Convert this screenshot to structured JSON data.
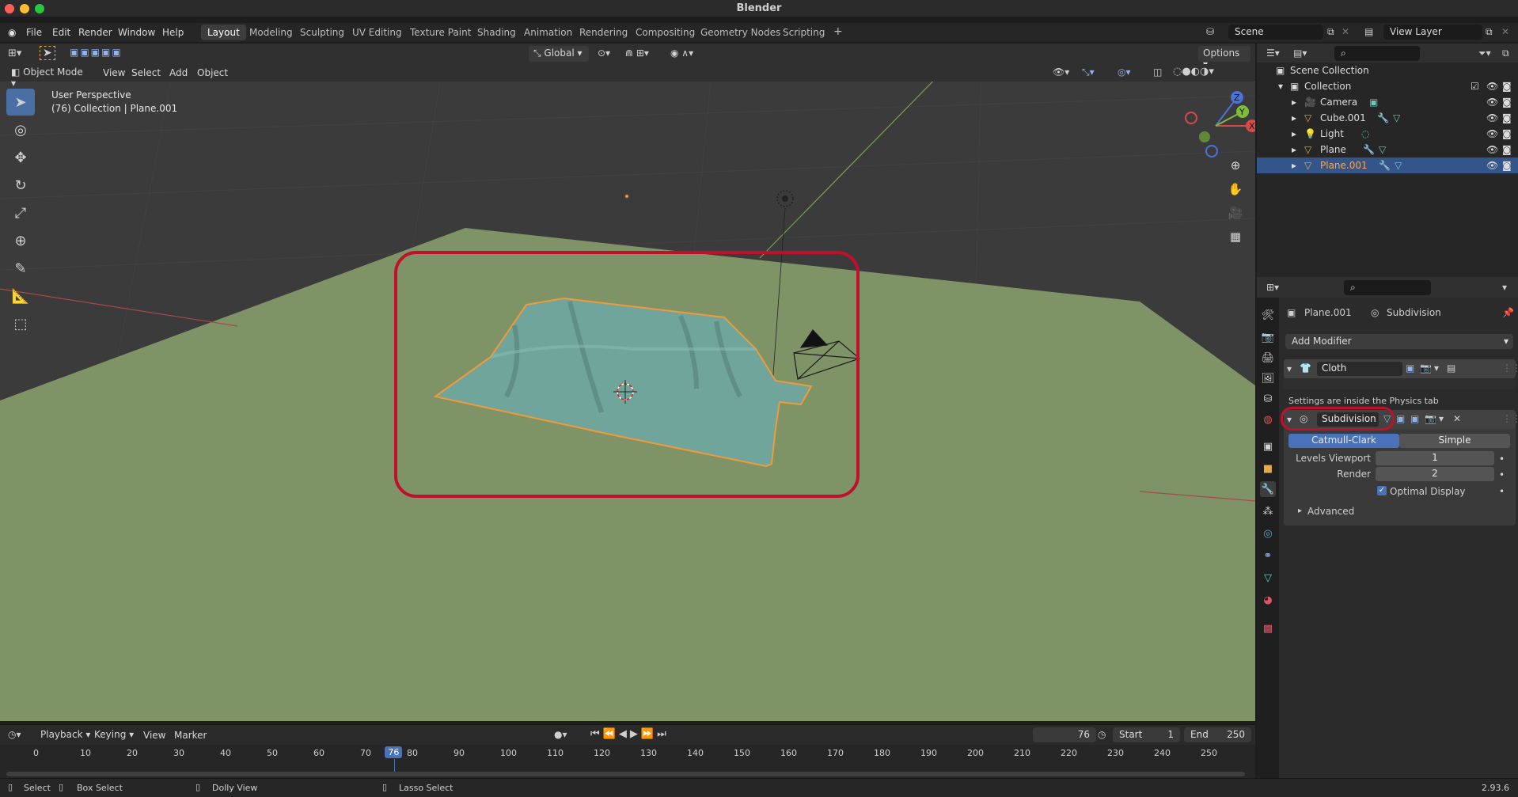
{
  "window": {
    "title": "Blender",
    "version": "2.93.6"
  },
  "menu": [
    "File",
    "Edit",
    "Render",
    "Window",
    "Help"
  ],
  "workspaces": [
    {
      "label": "Layout",
      "active": true
    },
    {
      "label": "Modeling",
      "active": false
    },
    {
      "label": "Sculpting",
      "active": false
    },
    {
      "label": "UV Editing",
      "active": false
    },
    {
      "label": "Texture Paint",
      "active": false
    },
    {
      "label": "Shading",
      "active": false
    },
    {
      "label": "Animation",
      "active": false
    },
    {
      "label": "Rendering",
      "active": false
    },
    {
      "label": "Compositing",
      "active": false
    },
    {
      "label": "Geometry Nodes",
      "active": false
    },
    {
      "label": "Scripting",
      "active": false
    }
  ],
  "add_workspace_label": "+",
  "scene": {
    "name": "Scene",
    "view_layer": "View Layer"
  },
  "viewport": {
    "transform_orientation": "Global",
    "options_label": "Options",
    "mode": "Object Mode",
    "header_menus": [
      "View",
      "Select",
      "Add",
      "Object"
    ],
    "perspective_label": "User Perspective",
    "collection_label": "(76) Collection | Plane.001",
    "gizmo_axes": {
      "x": "X",
      "y": "Y",
      "z": "Z"
    }
  },
  "outliner": {
    "root": "Scene Collection",
    "collection": "Collection",
    "items": [
      {
        "name": "Camera",
        "selected": false
      },
      {
        "name": "Cube.001",
        "selected": false
      },
      {
        "name": "Light",
        "selected": false
      },
      {
        "name": "Plane",
        "selected": false
      },
      {
        "name": "Plane.001",
        "selected": true
      }
    ]
  },
  "properties": {
    "object_name": "Plane.001",
    "modifier_context": "Subdivision",
    "add_modifier_label": "Add Modifier",
    "cloth": {
      "name": "Cloth",
      "note": "Settings are inside the Physics tab"
    },
    "subdivision": {
      "name": "Subdivision",
      "algorithms": [
        "Catmull-Clark",
        "Simple"
      ],
      "active_algorithm": "Catmull-Clark",
      "levels_viewport_label": "Levels Viewport",
      "levels_viewport": "1",
      "render_label": "Render",
      "render": "2",
      "optimal_display_label": "Optimal Display",
      "optimal_display": true,
      "advanced_label": "Advanced"
    }
  },
  "timeline": {
    "menus": [
      "Playback",
      "Keying",
      "View",
      "Marker"
    ],
    "current_frame": "76",
    "start_label": "Start",
    "start": "1",
    "end_label": "End",
    "end": "250",
    "ticks": [
      "0",
      "10",
      "20",
      "30",
      "40",
      "50",
      "60",
      "70",
      "76",
      "80",
      "90",
      "100",
      "110",
      "120",
      "130",
      "140",
      "150",
      "160",
      "170",
      "180",
      "190",
      "200",
      "210",
      "220",
      "230",
      "240",
      "250"
    ]
  },
  "statusbar": {
    "items": [
      "Select",
      "Box Select",
      "Dolly View",
      "Lasso Select"
    ]
  },
  "colors": {
    "accent": "#4a72b8",
    "highlight_red": "#c0102a",
    "cloth": "#6fa59a",
    "floor": "#7f9466",
    "selection_outline": "#f29a3a"
  }
}
